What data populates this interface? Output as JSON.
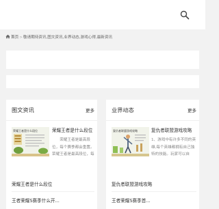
{
  "breadcrumb": {
    "home": "首页",
    "items": [
      "敬请期待资讯,图文资讯,业界动态,游戏心得,最新资讯"
    ]
  },
  "left_panel": {
    "title": "图文资讯",
    "more": "更多",
    "featured": {
      "thumb_caption": "荣耀王者是什么段位",
      "title": "荣耀王者是什么段位",
      "desc": "荣耀王者是最高段位，每个赛季都会重置。荣耀王者是最高段位，每个赛季都"
    },
    "list": [
      "荣耀王者是什么段位",
      "王者荣耀S赛季什么开..."
    ]
  },
  "right_panel": {
    "title": "业界动态",
    "more": "更多",
    "featured": {
      "thumb_caption": "复仇者联盟游戏攻略",
      "title": "复仇者联盟游戏攻略",
      "desc": "1、游戏中有许多不同的英雄,每个英雄都拥有自己独特的技能。玩家可以自"
    },
    "list": [
      "复仇者联盟游戏攻略",
      "王者荣耀S赛季首..."
    ]
  },
  "icons": {
    "search": "search-icon",
    "home": "home-icon"
  }
}
